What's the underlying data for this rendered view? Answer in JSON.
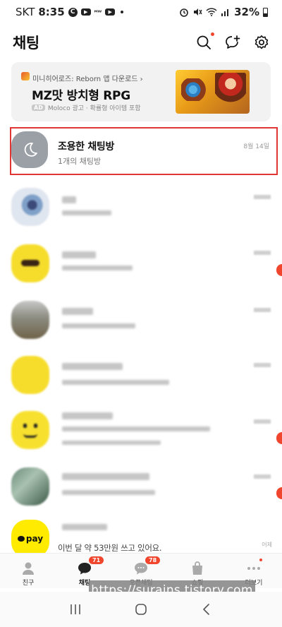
{
  "status_bar": {
    "carrier": "SKT",
    "time": "8:35",
    "battery": "32%",
    "icons": [
      "c-icon",
      "youtube-icon",
      "mw-icon",
      "youtube-icon",
      "dot-icon",
      "alarm-icon",
      "mute-icon",
      "wifi-icon",
      "signal-icon",
      "battery-icon"
    ]
  },
  "header": {
    "title": "채팅",
    "icons": [
      "search-icon",
      "new-chat-icon",
      "settings-icon"
    ]
  },
  "ad": {
    "app_line": "미니히어로즈: Reborn 앱 다운로드 ›",
    "title": "MZ맛 방치형 RPG",
    "badge": "AD",
    "sub": "Moloco 광고 · 확률형 아이템 포함"
  },
  "quiet_chat": {
    "title": "조용한 채팅방",
    "subtitle": "1개의 채팅방",
    "time": "8월 14일",
    "icon": "moon-icon"
  },
  "pay_chat": {
    "logo": "pay",
    "message": "이번 달 약 53만원 쓰고 있어요.",
    "time": "어제"
  },
  "bottom_nav": {
    "items": [
      {
        "label": "친구",
        "icon": "friends-icon"
      },
      {
        "label": "채팅",
        "icon": "chat-icon",
        "badge": "71"
      },
      {
        "label": "오픈채팅",
        "icon": "open-chat-icon",
        "badge": "78"
      },
      {
        "label": "쇼핑",
        "icon": "shopping-icon"
      },
      {
        "label": "더보기",
        "icon": "more-icon"
      }
    ]
  },
  "watermark": "https://surains.tistory.com",
  "system_nav": [
    "recents-icon",
    "home-icon",
    "back-icon"
  ],
  "colors": {
    "accent_red": "#f0462e",
    "highlight_border": "#e03535",
    "kakao_yellow": "#f6dd2c",
    "pay_yellow": "#ffeb00"
  }
}
